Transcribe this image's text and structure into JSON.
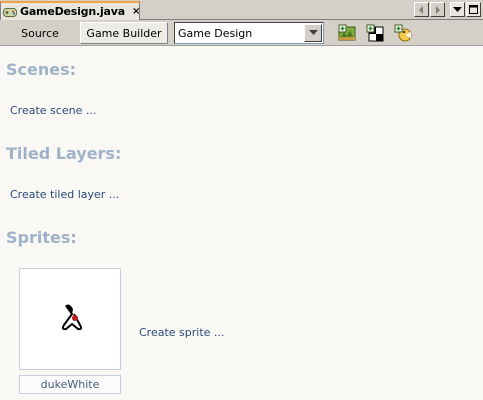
{
  "editor_tab": {
    "title": "GameDesign.java",
    "close_glyph": "×",
    "icon": "game-design-file-icon"
  },
  "window_controls": {
    "scroll_left_icon": "chevron-left-icon",
    "scroll_right_icon": "chevron-right-icon",
    "dropdown_icon": "chevron-down-icon",
    "maximize_icon": "maximize-icon"
  },
  "toolbar": {
    "source_label": "Source",
    "game_builder_label": "Game Builder",
    "design_select_value": "Game Design",
    "buttons": [
      "new-scene-icon",
      "new-tiled-layer-icon",
      "new-sprite-icon"
    ]
  },
  "sections": {
    "scenes": {
      "title": "Scenes:",
      "action": "Create scene ..."
    },
    "tiled_layers": {
      "title": "Tiled Layers:",
      "action": "Create tiled layer ..."
    },
    "sprites": {
      "title": "Sprites:",
      "action": "Create sprite ...",
      "items": [
        {
          "name": "dukeWhite",
          "icon": "duke-sprite-icon"
        }
      ]
    }
  },
  "colors": {
    "section_title": "#9fb2c8",
    "link": "#2c4a7c",
    "background": "#f9f8f4",
    "tab_accent": "#f2a34a"
  }
}
